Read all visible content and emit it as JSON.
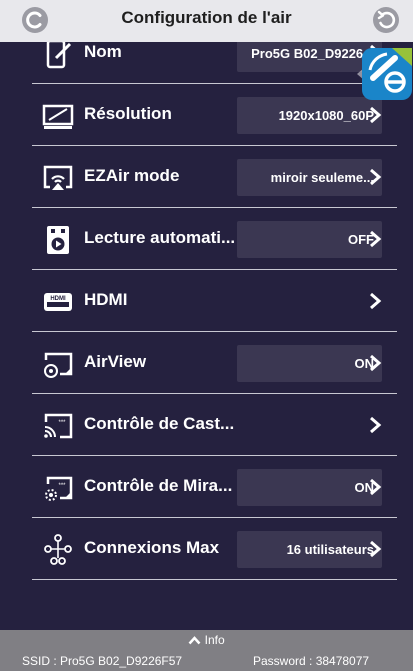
{
  "header": {
    "title": "Configuration de l'air",
    "left_icon": "settings-c-icon",
    "right_icon": "refresh-icon"
  },
  "settings": [
    {
      "label": "Nom",
      "value": "Pro5G B02_D9226...",
      "icon": "device-edit-icon"
    },
    {
      "label": "Résolution",
      "value": "1920x1080_60P",
      "icon": "monitor-icon"
    },
    {
      "label": "EZAir mode",
      "value": "miroir seuleme...",
      "icon": "cast-screen-icon"
    },
    {
      "label": "Lecture automati...",
      "value": "OFF",
      "icon": "autoplay-icon"
    },
    {
      "label": "HDMI",
      "value": "",
      "icon": "hdmi-icon"
    },
    {
      "label": "AirView",
      "value": "ON",
      "icon": "airview-icon"
    },
    {
      "label": "Contrôle de Cast...",
      "value": "",
      "icon": "cast-control-icon"
    },
    {
      "label": "Contrôle de Mira...",
      "value": "ON",
      "icon": "miracast-control-icon"
    },
    {
      "label": "Connexions Max",
      "value": "16 utilisateurs",
      "icon": "network-nodes-icon"
    }
  ],
  "info": {
    "toggle_label": "Info",
    "ssid": "SSID : Pro5G B02_D9226F57",
    "password": "Password : 38478077"
  },
  "colors": {
    "background": "#25213f",
    "topbar": "#e8e8ec",
    "value_box": "#3b3752",
    "info_bar": "#807f84"
  }
}
